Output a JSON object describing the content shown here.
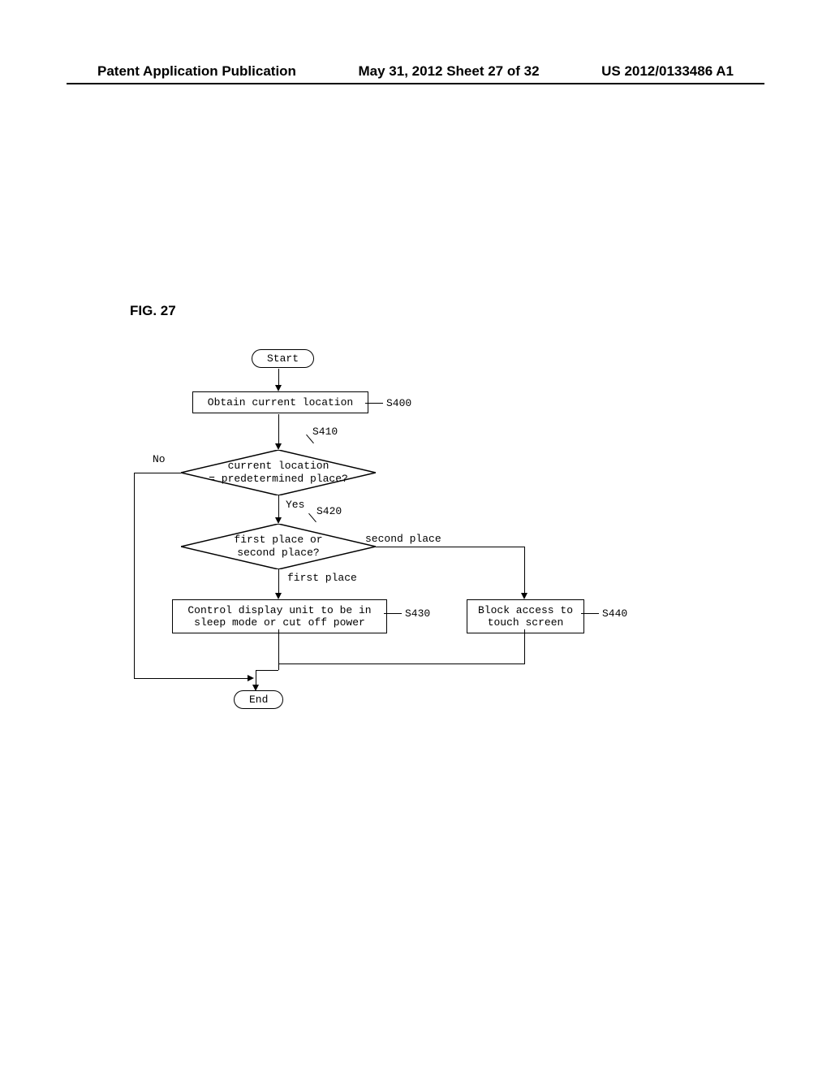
{
  "header": {
    "left": "Patent Application Publication",
    "center": "May 31, 2012  Sheet 27 of 32",
    "right": "US 2012/0133486 A1"
  },
  "figure": {
    "label": "FIG. 27"
  },
  "flowchart": {
    "start": "Start",
    "end": "End",
    "step_obtain": "Obtain current location",
    "step_sleep": "Control display unit to be in\nsleep mode or cut off power",
    "step_block": "Block access to\ntouch screen",
    "decision_location": "current location\n= predetermined place?",
    "decision_place": "first place or\nsecond place?",
    "labels": {
      "no": "No",
      "yes": "Yes",
      "second_place": "second place",
      "first_place": "first place",
      "s400": "S400",
      "s410": "S410",
      "s420": "S420",
      "s430": "S430",
      "s440": "S440"
    }
  }
}
